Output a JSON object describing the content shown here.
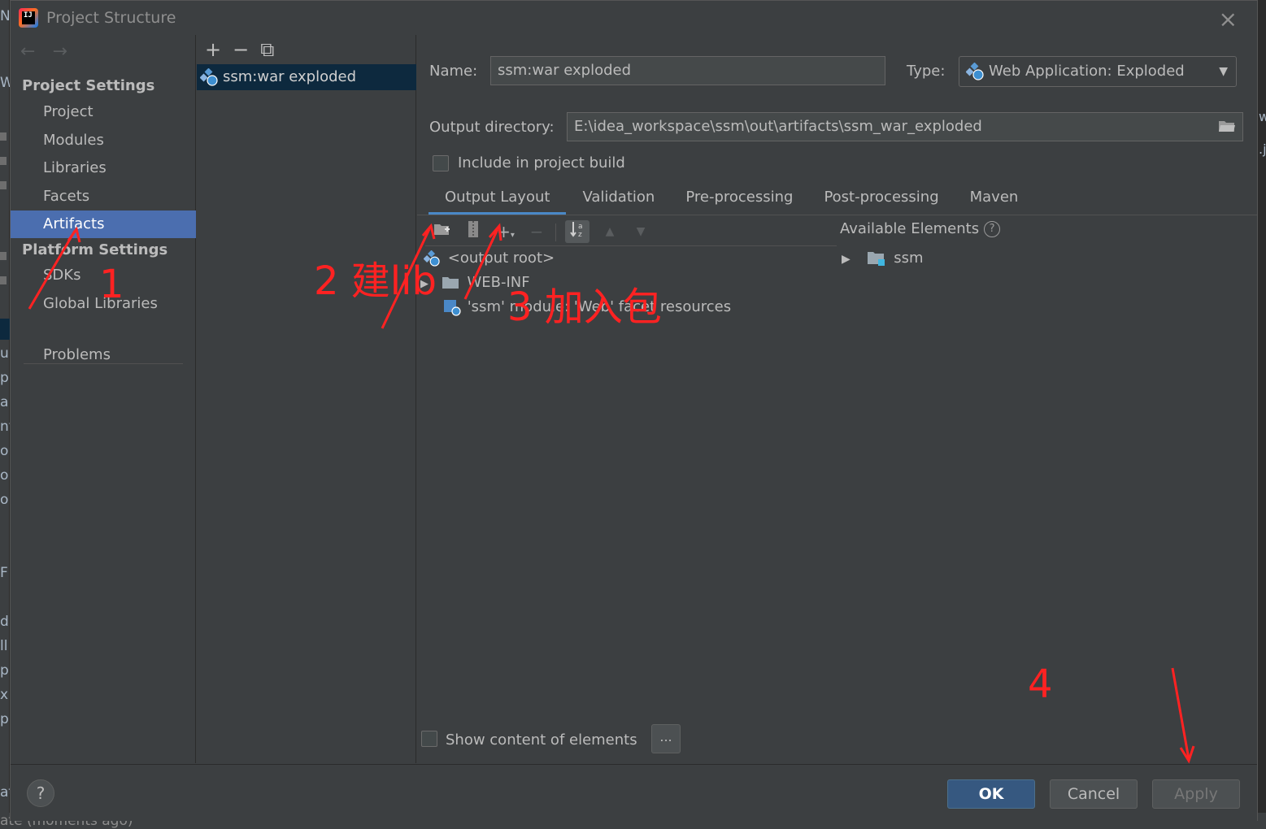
{
  "window": {
    "title": "Project Structure",
    "close_icon": "×"
  },
  "background": {
    "left_glyphs": [
      "N",
      "W",
      "u",
      "p",
      "a",
      "ny",
      "oı",
      "oı",
      "oı",
      "F",
      "d",
      "ll",
      "p",
      "x",
      "p",
      "at"
    ],
    "right_glyphs": [
      "w",
      ".ja"
    ],
    "bottom_text": "ate (moments ago)"
  },
  "nav": {
    "back_arrow": "←",
    "forward_arrow": "→",
    "project_settings_header": "Project Settings",
    "project_settings_items": [
      "Project",
      "Modules",
      "Libraries",
      "Facets",
      "Artifacts"
    ],
    "selected": "Artifacts",
    "platform_settings_header": "Platform Settings",
    "platform_settings_items": [
      "SDKs",
      "Global Libraries"
    ],
    "problems": "Problems"
  },
  "artifacts": {
    "toolbar": {
      "add": "+",
      "remove": "−",
      "copy": "⧉"
    },
    "items": [
      "ssm:war exploded"
    ]
  },
  "form": {
    "name_label": "Name:",
    "name_value": "ssm:war exploded",
    "type_label": "Type:",
    "type_value": "Web Application: Exploded",
    "output_dir_label": "Output directory:",
    "output_dir_value": "E:\\idea_workspace\\ssm\\out\\artifacts\\ssm_war_exploded",
    "include_label": "Include in project build",
    "include_checked": false
  },
  "tabs": [
    "Output Layout",
    "Validation",
    "Pre-processing",
    "Post-processing",
    "Maven"
  ],
  "active_tab": "Output Layout",
  "layout": {
    "tree": [
      "<output root>",
      "WEB-INF",
      "'ssm' module: 'Web' facet resources"
    ],
    "available_title": "Available Elements",
    "available_items": [
      "ssm"
    ],
    "show_content_label": "Show content of elements",
    "dots_label": "..."
  },
  "buttons": {
    "help": "?",
    "ok": "OK",
    "cancel": "Cancel",
    "apply": "Apply"
  },
  "annotations": [
    "1",
    "2 建lib",
    "3 加入包",
    "4"
  ],
  "colors": {
    "accent": "#4b6eaf",
    "annotation": "#ff2222",
    "ok_button": "#365880"
  }
}
